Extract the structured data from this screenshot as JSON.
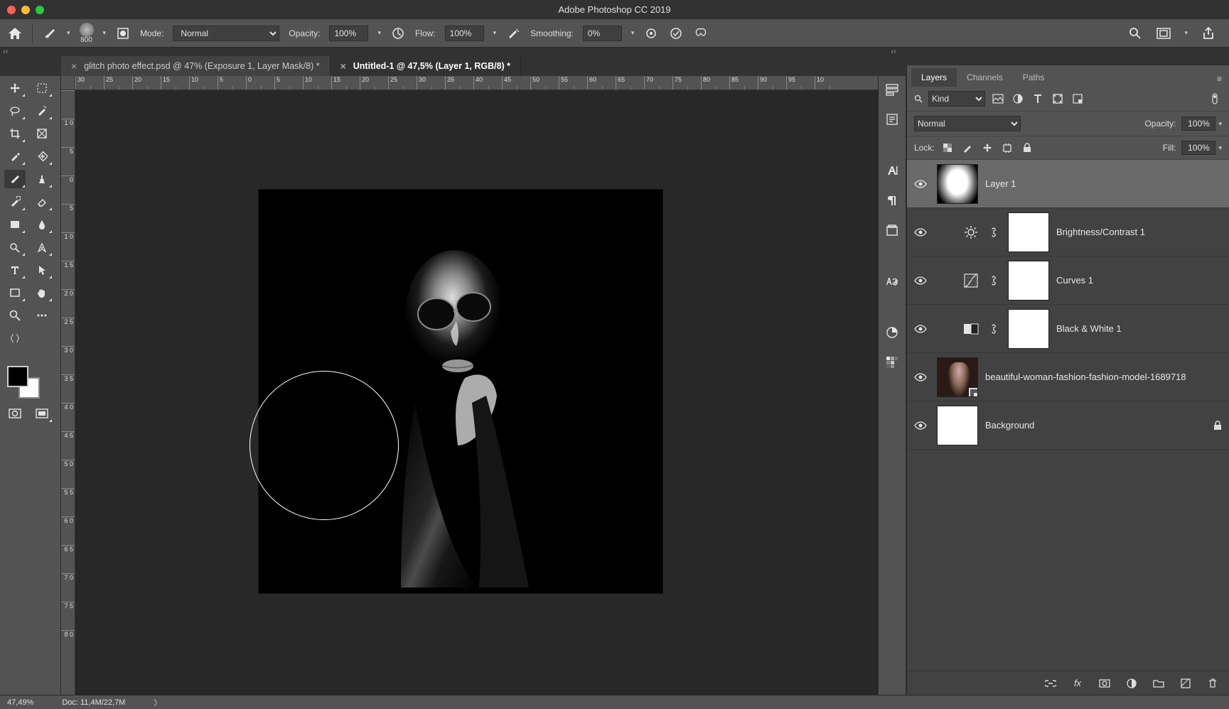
{
  "app_title": "Adobe Photoshop CC 2019",
  "options": {
    "brush_size": "800",
    "mode_label": "Mode:",
    "mode_value": "Normal",
    "opacity_label": "Opacity:",
    "opacity_value": "100%",
    "flow_label": "Flow:",
    "flow_value": "100%",
    "smoothing_label": "Smoothing:",
    "smoothing_value": "0%"
  },
  "tabs": [
    {
      "label": "glitch photo effect.psd @ 47% (Exposure 1, Layer Mask/8) *",
      "active": false
    },
    {
      "label": "Untitled-1 @ 47,5% (Layer 1, RGB/8) *",
      "active": true
    }
  ],
  "ruler_h": [
    "30",
    "25",
    "20",
    "15",
    "10",
    "5",
    "0",
    "5",
    "10",
    "15",
    "20",
    "25",
    "30",
    "35",
    "40",
    "45",
    "50",
    "55",
    "60",
    "65",
    "70",
    "75",
    "80",
    "85",
    "90",
    "95",
    "10"
  ],
  "ruler_v": [
    "",
    "1 0",
    "5",
    "0",
    "5",
    "1 0",
    "1 5",
    "2 0",
    "2 5",
    "3 0",
    "3 5",
    "4 0",
    "4 5",
    "5 0",
    "5 5",
    "6 0",
    "6 5",
    "7 0",
    "7 5",
    "8 0"
  ],
  "panels": {
    "tabs": [
      "Layers",
      "Channels",
      "Paths"
    ],
    "active_tab": 0,
    "filter_kind_label": "Kind",
    "blend_mode": "Normal",
    "opacity_label": "Opacity:",
    "opacity_value": "100%",
    "lock_label": "Lock:",
    "fill_label": "Fill:",
    "fill_value": "100%"
  },
  "layers": [
    {
      "name": "Layer 1",
      "visible": true,
      "selected": true,
      "type": "pixel",
      "thumb": "layer1"
    },
    {
      "name": "Brightness/Contrast 1",
      "visible": true,
      "type": "adjustment",
      "adj_icon": "sun"
    },
    {
      "name": "Curves 1",
      "visible": true,
      "type": "adjustment",
      "adj_icon": "curves"
    },
    {
      "name": "Black & White 1",
      "visible": true,
      "type": "adjustment",
      "adj_icon": "bw"
    },
    {
      "name": "beautiful-woman-fashion-fashion-model-1689718",
      "visible": true,
      "type": "smart",
      "thumb": "woman"
    },
    {
      "name": "Background",
      "visible": true,
      "type": "pixel",
      "locked": true,
      "thumb": "white"
    }
  ],
  "status": {
    "zoom": "47,49%",
    "doc_size": "Doc: 11,4M/22,7M"
  }
}
